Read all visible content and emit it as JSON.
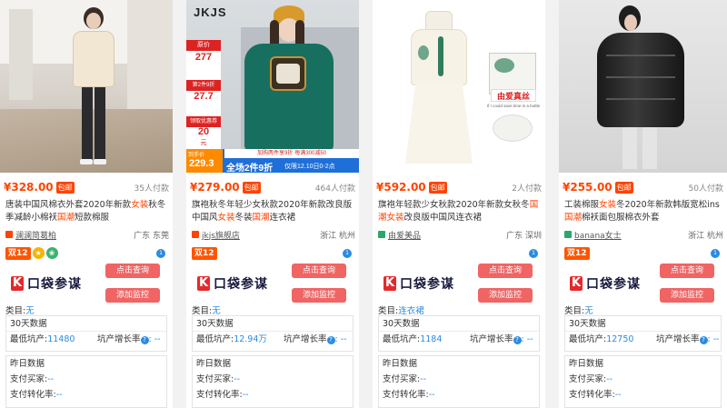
{
  "labels": {
    "baoyou": "包邮",
    "query_btn": "点击查询",
    "monitor_btn": "添加监控",
    "category_prefix": "类目:",
    "data30": "30天数据",
    "min_pit": "最低坑产:",
    "pit_growth": "坑产增长率",
    "yesterday": "昨日数据",
    "buyers": "支付买家:",
    "conv": "支付转化率:",
    "dash": "--",
    "logo_k": "K",
    "logo_text": "口袋参谋",
    "badge_1212": "双12"
  },
  "colors": {
    "price": "#ff4400",
    "link": "#2a8be0",
    "button": "#f06464",
    "logo": "#e4292c"
  },
  "products": [
    {
      "price": "¥328.00",
      "sold": "35人付款",
      "title_parts": [
        "唐装中国风棉衣外套2020年新款",
        "女装",
        "秋冬季减龄小棉袄",
        "国潮",
        "短款棉服"
      ],
      "shop": "澜澜简葛柏",
      "location": "广东 东莞",
      "category_value": "无",
      "min_pit": "11480",
      "growth": ": --",
      "buyers": "--",
      "conv": "--"
    },
    {
      "price": "¥279.00",
      "sold": "464人付款",
      "title_parts": [
        "旗袍秋冬年轻少女秋款2020年新款改良版中国风",
        "女装",
        "冬装",
        "国潮",
        "连衣裙"
      ],
      "shop": "jkjs旗舰店",
      "location": "浙江 杭州",
      "category_value": "无",
      "min_pit": "12.94万",
      "growth": ": --",
      "buyers": "--",
      "conv": "--",
      "image_text": {
        "brand": "JKJS",
        "p1_label": "原价",
        "p1": "277",
        "p2_label": "第2件9折",
        "p2": "27.7",
        "p3_label": "领取优惠券",
        "p3": "20",
        "p3_unit": "元",
        "final_label": "到手价",
        "final": "229.3",
        "banner": "全场2件9折",
        "banner_sub": "仅限12.10日0-2点",
        "coupon_note": "加购两件享9折·每满300减50"
      }
    },
    {
      "price": "¥592.00",
      "sold": "2人付款",
      "title_parts": [
        "旗袍年轻款少女秋款2020年新款女秋冬",
        "国潮",
        "",
        "女装",
        "改良版中国风连衣裙"
      ],
      "shop": "由爱美品",
      "location": "广东 深圳",
      "category_value": "连衣裙",
      "min_pit": "1184",
      "growth": ": --",
      "buyers": "--",
      "conv": "--",
      "image_text": {
        "tag": "由爱真丝",
        "note": "If I could save time in a bottle"
      }
    },
    {
      "price": "¥255.00",
      "sold": "50人付款",
      "title_parts": [
        "工装棉服",
        "女装",
        "冬2020年新款韩版宽松ins",
        "国潮",
        "棉袄面包服棉衣外套"
      ],
      "shop": "banana女士",
      "location": "浙江 杭州",
      "category_value": "无",
      "min_pit": "12750",
      "growth": ": --",
      "buyers": "--",
      "conv": "--"
    }
  ]
}
